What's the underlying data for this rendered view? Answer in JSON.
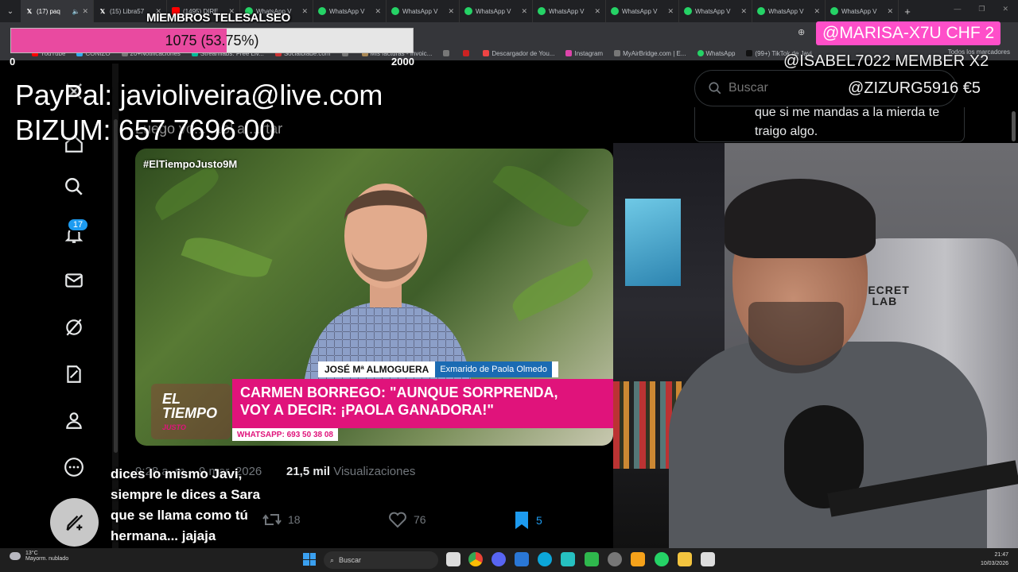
{
  "browser": {
    "tabs": [
      {
        "label": "(17) paq",
        "icon": "x-logo",
        "active": true,
        "mute": true
      },
      {
        "label": "(15) Libra57",
        "icon": "x-logo"
      },
      {
        "label": "(1495) DIRE",
        "icon": "youtube-icon"
      },
      {
        "label": "WhatsApp V",
        "icon": "whatsapp-icon"
      },
      {
        "label": "WhatsApp V",
        "icon": "whatsapp-icon"
      },
      {
        "label": "WhatsApp V",
        "icon": "whatsapp-icon"
      },
      {
        "label": "WhatsApp V",
        "icon": "whatsapp-icon"
      },
      {
        "label": "WhatsApp V",
        "icon": "whatsapp-icon"
      },
      {
        "label": "WhatsApp V",
        "icon": "whatsapp-icon"
      },
      {
        "label": "WhatsApp V",
        "icon": "whatsapp-icon"
      },
      {
        "label": "WhatsApp V",
        "icon": "whatsapp-icon"
      },
      {
        "label": "WhatsApp V",
        "icon": "whatsapp-icon"
      }
    ],
    "new_tab": "+",
    "bookmarks": [
      "YouTube",
      "CONIZO",
      "20+Notificaciones",
      "Streamlabs: Free Liv...",
      "Socialblade.com",
      "",
      "Mis facturas - Invoic...",
      "",
      "",
      "Descargador de You...",
      "Instagram",
      "MyAirBridge.com | E...",
      "WhatsApp",
      "(99+) TikTok de Javi"
    ],
    "all_bookmarks": "Todos los marcadores"
  },
  "goal": {
    "title": "MIEMBROS TELESALSEO",
    "current": 1075,
    "percent": 53.75,
    "text": "1075 (53.75%)",
    "min": "0",
    "max": "2000",
    "fill_color": "#e94aa0"
  },
  "donations": {
    "top": "@MARISA-X7U  CHF 2",
    "second": "@ISABEL7022  MEMBER X2",
    "third": "@ZIZURG5916  €5",
    "highlight_color": "#ff4fc9"
  },
  "payment": {
    "paypal": "PayPal: javioliveira@live.com",
    "bizum": "BIZUM: 657 7696 00"
  },
  "x": {
    "tweet_text_partial": "Luego vo...  ...ol a ...rtar",
    "notifications_count": "17",
    "nav_icons": [
      "x-logo-icon",
      "home-icon",
      "search-icon",
      "bell-icon",
      "mail-icon",
      "grok-icon",
      "premium-icon",
      "profile-icon",
      "more-icon"
    ],
    "video": {
      "hashtag": "#ElTiempoJusto9M",
      "name": "JOSÉ Mª ALMOGUERA",
      "role": "Exmarido de Paola Olmedo",
      "headline_1": "CARMEN BORREGO: \"AUNQUE SORPRENDA,",
      "headline_2": "VOY A DECIR: ¡PAOLA GANADORA!\"",
      "whatsapp": "WHATSAPP: 693 50 38 08",
      "logo_1": "EL",
      "logo_2": "TIEMPO",
      "logo_3": "JUSTO"
    },
    "date": "9:28 a. m. · 9 mar. 2026",
    "views_count": "21,5 mil",
    "views_label": "Visualizaciones",
    "retweets": "18",
    "likes": "76",
    "bookmarks": "5",
    "search_placeholder": "Buscar",
    "sidebar_message": "que si me mandas a la mierda te traigo algo."
  },
  "chat": {
    "message": "dices lo mismo Javi, siempre le dices a Sara que se llama como tú hermana... jajaja"
  },
  "webcam": {
    "chair_brand_1": "SECRET",
    "chair_brand_2": "LAB"
  },
  "taskbar": {
    "temperature": "13°C",
    "weather": "Mayorm. nublado",
    "search": "Buscar",
    "time": "21:47",
    "date": "10/03/2026"
  }
}
